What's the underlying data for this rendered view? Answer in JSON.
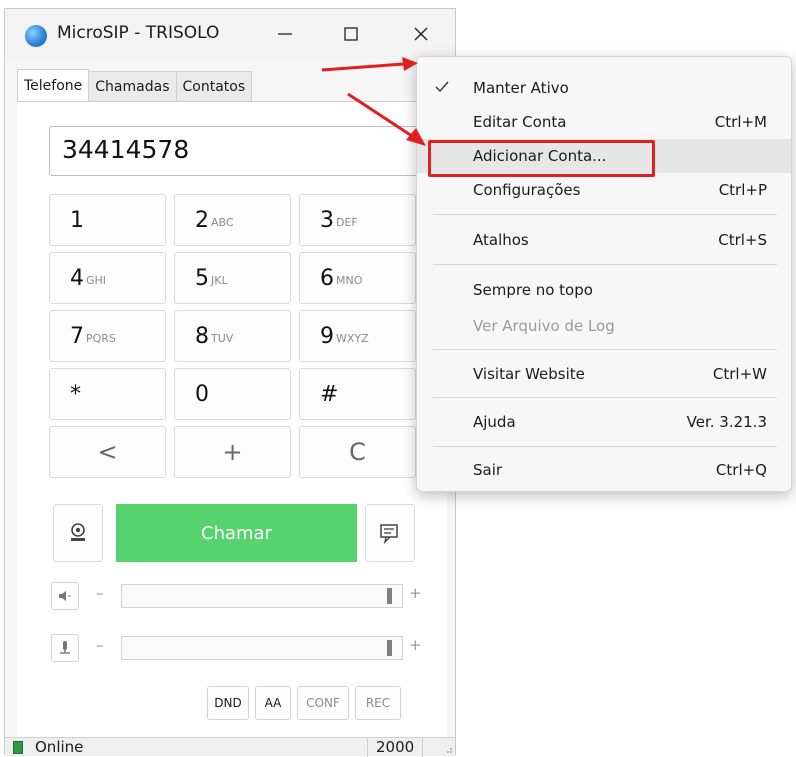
{
  "window": {
    "title": "MicroSIP - TRISOLO",
    "tabs": [
      "Telefone",
      "Chamadas",
      "Contatos"
    ],
    "number_value": "34414578"
  },
  "keypad": [
    {
      "digit": "1",
      "letters": ""
    },
    {
      "digit": "2",
      "letters": "ABC"
    },
    {
      "digit": "3",
      "letters": "DEF"
    },
    {
      "digit": "4",
      "letters": "GHI"
    },
    {
      "digit": "5",
      "letters": "JKL"
    },
    {
      "digit": "6",
      "letters": "MNO"
    },
    {
      "digit": "7",
      "letters": "PQRS"
    },
    {
      "digit": "8",
      "letters": "TUV"
    },
    {
      "digit": "9",
      "letters": "WXYZ"
    },
    {
      "digit": "*",
      "letters": ""
    },
    {
      "digit": "0",
      "letters": ""
    },
    {
      "digit": "#",
      "letters": ""
    },
    {
      "digit": "<",
      "letters": ""
    },
    {
      "digit": "+",
      "letters": ""
    },
    {
      "digit": "C",
      "letters": ""
    }
  ],
  "call_button": "Chamar",
  "volume": {
    "minus": "–",
    "plus": "+"
  },
  "bottom_buttons": [
    "DND",
    "AA",
    "CONF",
    "REC"
  ],
  "status": {
    "text": "Online",
    "extension": "2000"
  },
  "menu": {
    "items": [
      {
        "label": "Manter Ativo",
        "shortcut": "",
        "checked": true
      },
      {
        "label": "Editar Conta",
        "shortcut": "Ctrl+M"
      },
      {
        "label": "Adicionar Conta...",
        "shortcut": ""
      },
      {
        "label": "Configurações",
        "shortcut": "Ctrl+P"
      },
      {
        "label": "Atalhos",
        "shortcut": "Ctrl+S"
      },
      {
        "label": "Sempre no topo",
        "shortcut": ""
      },
      {
        "label": "Ver Arquivo de Log",
        "shortcut": ""
      },
      {
        "label": "Visitar Website",
        "shortcut": "Ctrl+W"
      },
      {
        "label": "Ajuda",
        "shortcut": "Ver. 3.21.3"
      },
      {
        "label": "Sair",
        "shortcut": "Ctrl+Q"
      }
    ]
  },
  "colors": {
    "call_green": "#56d26f",
    "annotation_red": "#e02020",
    "status_green": "#2f9a44"
  },
  "icons": [
    "app-icon",
    "minimize-icon",
    "maximize-icon",
    "close-icon",
    "chevron-down-icon",
    "video-icon",
    "message-icon",
    "speaker-icon",
    "microphone-icon",
    "check-icon",
    "status-led-icon"
  ]
}
